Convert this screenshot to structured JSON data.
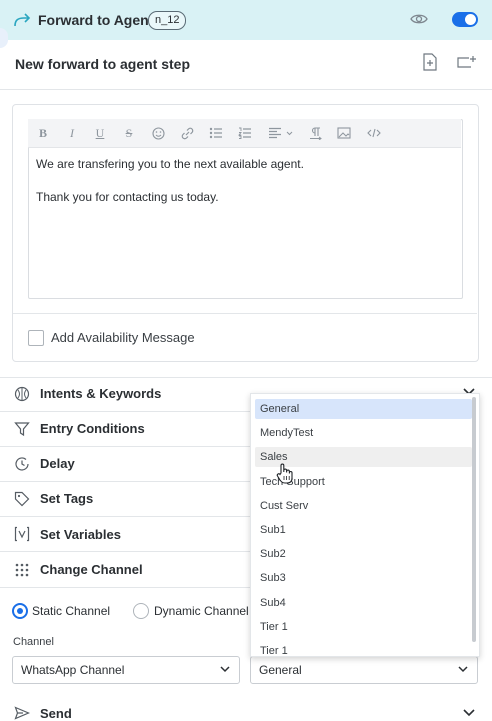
{
  "header": {
    "title": "Forward to Agent",
    "node_badge": "n_12"
  },
  "step": {
    "title": "New forward to agent step"
  },
  "editor": {
    "line1": "We are transfering you to the next available agent.",
    "line2": "Thank you for contacting us today."
  },
  "availability": {
    "label": "Add Availability Message",
    "checked": false
  },
  "sections": {
    "intents": "Intents & Keywords",
    "entry": "Entry Conditions",
    "delay": "Delay",
    "tags": "Set Tags",
    "variables": "Set Variables",
    "change_channel": "Change Channel",
    "send": "Send"
  },
  "channel": {
    "static_label": "Static Channel",
    "dynamic_label": "Dynamic Channel",
    "channel_label": "Channel",
    "channel_value": "WhatsApp Channel",
    "queue_value": "General"
  },
  "dropdown": {
    "options": [
      "General",
      "MendyTest",
      "Sales",
      "Tech Support",
      "Cust Serv",
      "Sub1",
      "Sub2",
      "Sub3",
      "Sub4",
      "Tier 1",
      "Tier 1"
    ],
    "selected": "General",
    "hovered": "Sales"
  },
  "colors": {
    "header_bg": "#d9f2f5",
    "accent": "#1a6fe8"
  }
}
